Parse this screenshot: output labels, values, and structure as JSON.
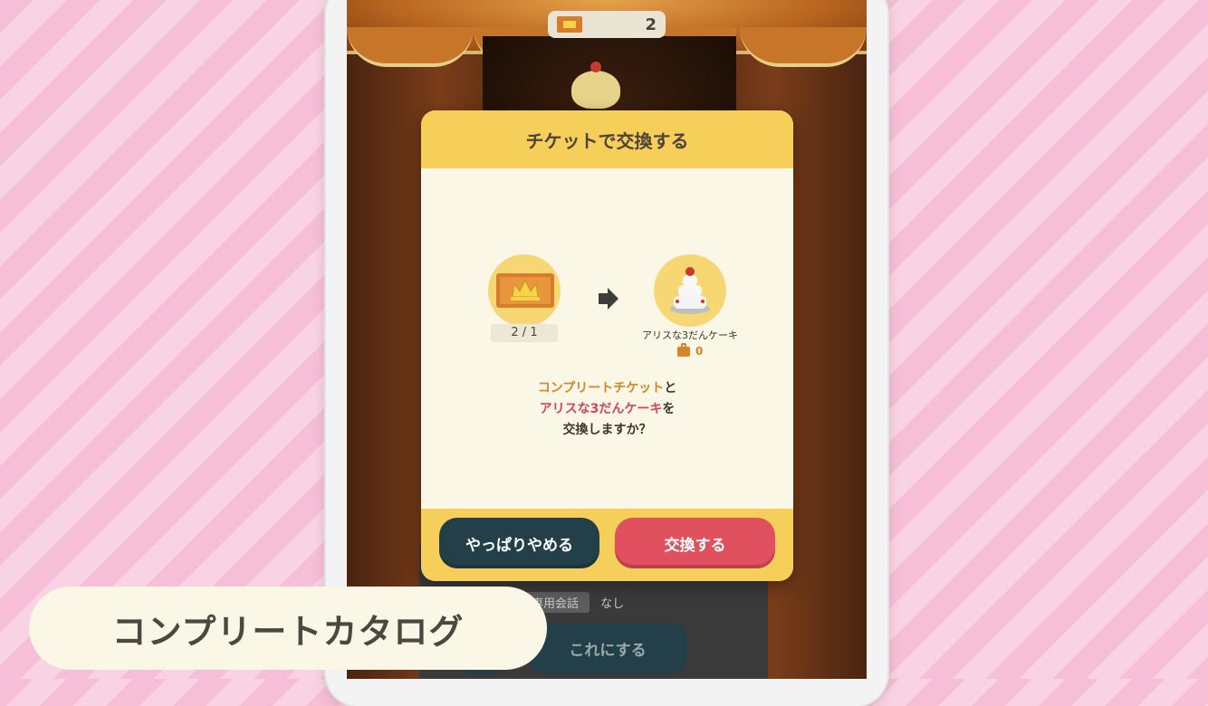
{
  "top_counter": {
    "value": "2"
  },
  "dialog": {
    "title": "チケットで交換する",
    "ticket_quantity": "2 / 1",
    "reward_name": "アリスな3だんケーキ",
    "owned_count": "0",
    "message": {
      "line1_highlight": "コンプリートチケット",
      "line1_suffix": "と",
      "line2_highlight": "アリスな3だんケーキ",
      "line2_suffix": "を",
      "line3": "交換しますか？"
    },
    "cancel_label": "やっぱりやめる",
    "confirm_label": "交換する"
  },
  "background_panel": {
    "chip_label": "専用会話",
    "chip_value": "なし",
    "button_label": "これにする"
  },
  "caption": {
    "text": "コンプリートカタログ"
  },
  "colors": {
    "header_yellow": "#f5cf5a",
    "cancel_button": "#23404a",
    "confirm_button": "#e0505e",
    "ticket_orange": "#d4852a",
    "cake_pink": "#d2455a",
    "background_pink": "#f6bfd7"
  },
  "icons": {
    "ticket": "ticket-icon",
    "arrow": "arrow-right-icon",
    "cake": "cake-icon",
    "bag": "bag-icon"
  }
}
